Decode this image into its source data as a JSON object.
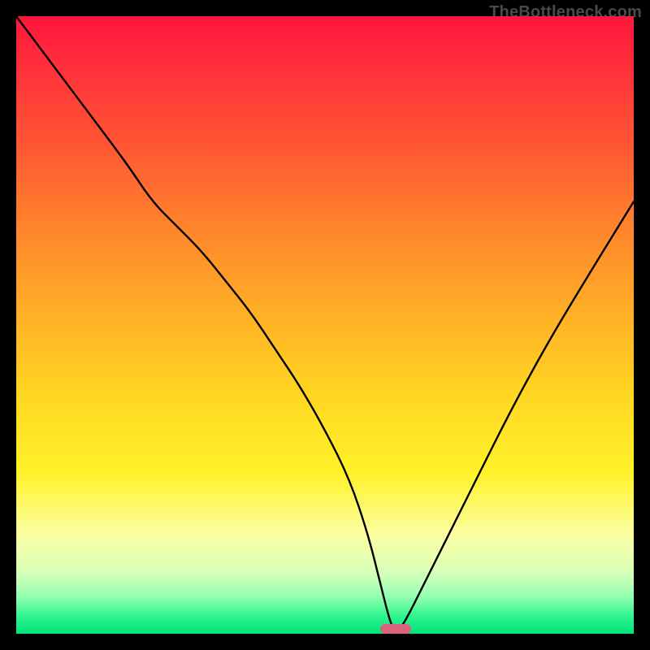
{
  "watermark": "TheBottleneck.com",
  "chart_data": {
    "type": "line",
    "title": "",
    "xlabel": "",
    "ylabel": "",
    "xlim": [
      0,
      100
    ],
    "ylim": [
      0,
      100
    ],
    "grid": false,
    "legend": false,
    "annotations": [],
    "series": [
      {
        "name": "bottleneck-curve",
        "x": [
          0,
          6,
          12,
          18,
          22,
          26,
          30,
          34,
          38,
          42,
          46,
          50,
          54,
          57,
          59,
          60.5,
          61.5,
          63,
          66,
          70,
          75,
          80,
          86,
          92,
          100
        ],
        "values": [
          100,
          92,
          84,
          76,
          70,
          66,
          62,
          57,
          52,
          46,
          40,
          33,
          25,
          16,
          8,
          2,
          0,
          2,
          8,
          16,
          26,
          36,
          47,
          57,
          70
        ]
      }
    ],
    "marker": {
      "x": 61.5,
      "width_percent": 5,
      "color": "#d9637a"
    },
    "background_gradient": {
      "top_color": "#ff163d",
      "bottom_color": "#00e37a",
      "stops": [
        {
          "pos": 0,
          "color": "#ff163d"
        },
        {
          "pos": 22,
          "color": "#ff5a33"
        },
        {
          "pos": 50,
          "color": "#ffb525"
        },
        {
          "pos": 74,
          "color": "#fff229"
        },
        {
          "pos": 90,
          "color": "#d8ffb8"
        },
        {
          "pos": 100,
          "color": "#00e37a"
        }
      ]
    }
  }
}
